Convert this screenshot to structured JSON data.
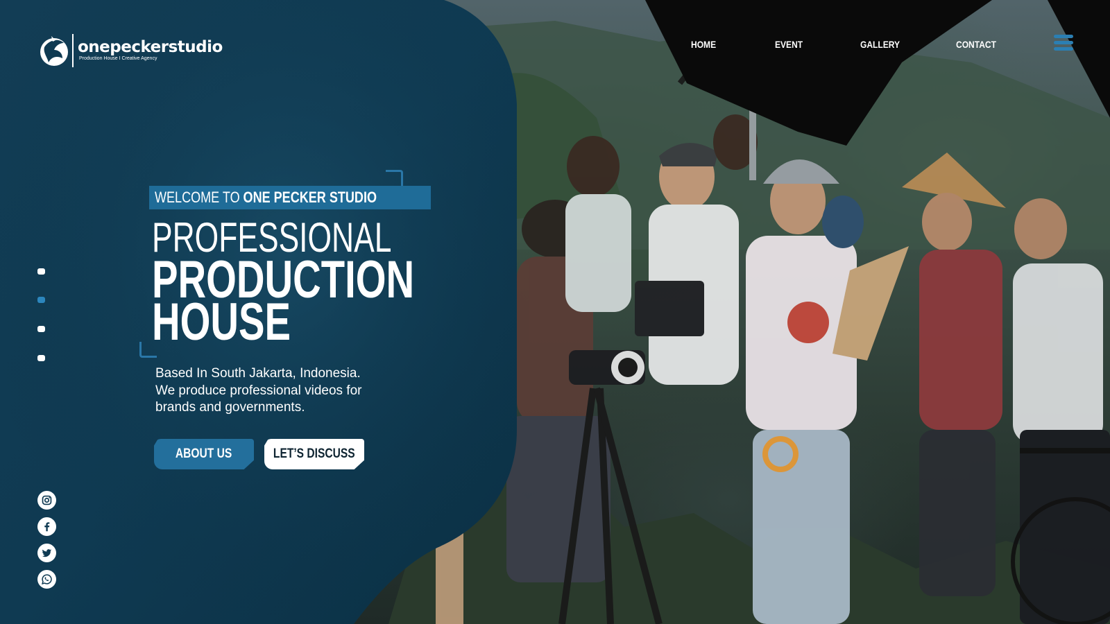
{
  "brand": {
    "name": "onepeckerstudio",
    "tagline": "Production House I Creative Agency",
    "accent": "#236f9c",
    "panel_color": "#0e3a52"
  },
  "nav": {
    "items": [
      {
        "label": "HOME"
      },
      {
        "label": "EVENT"
      },
      {
        "label": "GALLERY"
      },
      {
        "label": "CONTACT"
      }
    ],
    "menu_icon": "hamburger-icon"
  },
  "hero": {
    "welcome_prefix": "WELCOME TO",
    "welcome_name": "ONE PECKER STUDIO",
    "headline_line1": "PROFESSIONAL",
    "headline_line2": "PRODUCTION",
    "headline_line3": "HOUSE",
    "description": [
      "Based In South Jakarta, Indonesia.",
      "We produce professional videos for",
      "brands and governments."
    ],
    "buttons": {
      "about": "ABOUT US",
      "discuss": "LET’S DISCUSS"
    }
  },
  "slider": {
    "dot_count": 4,
    "active_index": 1
  },
  "social": [
    {
      "icon": "instagram-icon"
    },
    {
      "icon": "facebook-icon"
    },
    {
      "icon": "twitter-icon"
    },
    {
      "icon": "whatsapp-icon"
    }
  ]
}
